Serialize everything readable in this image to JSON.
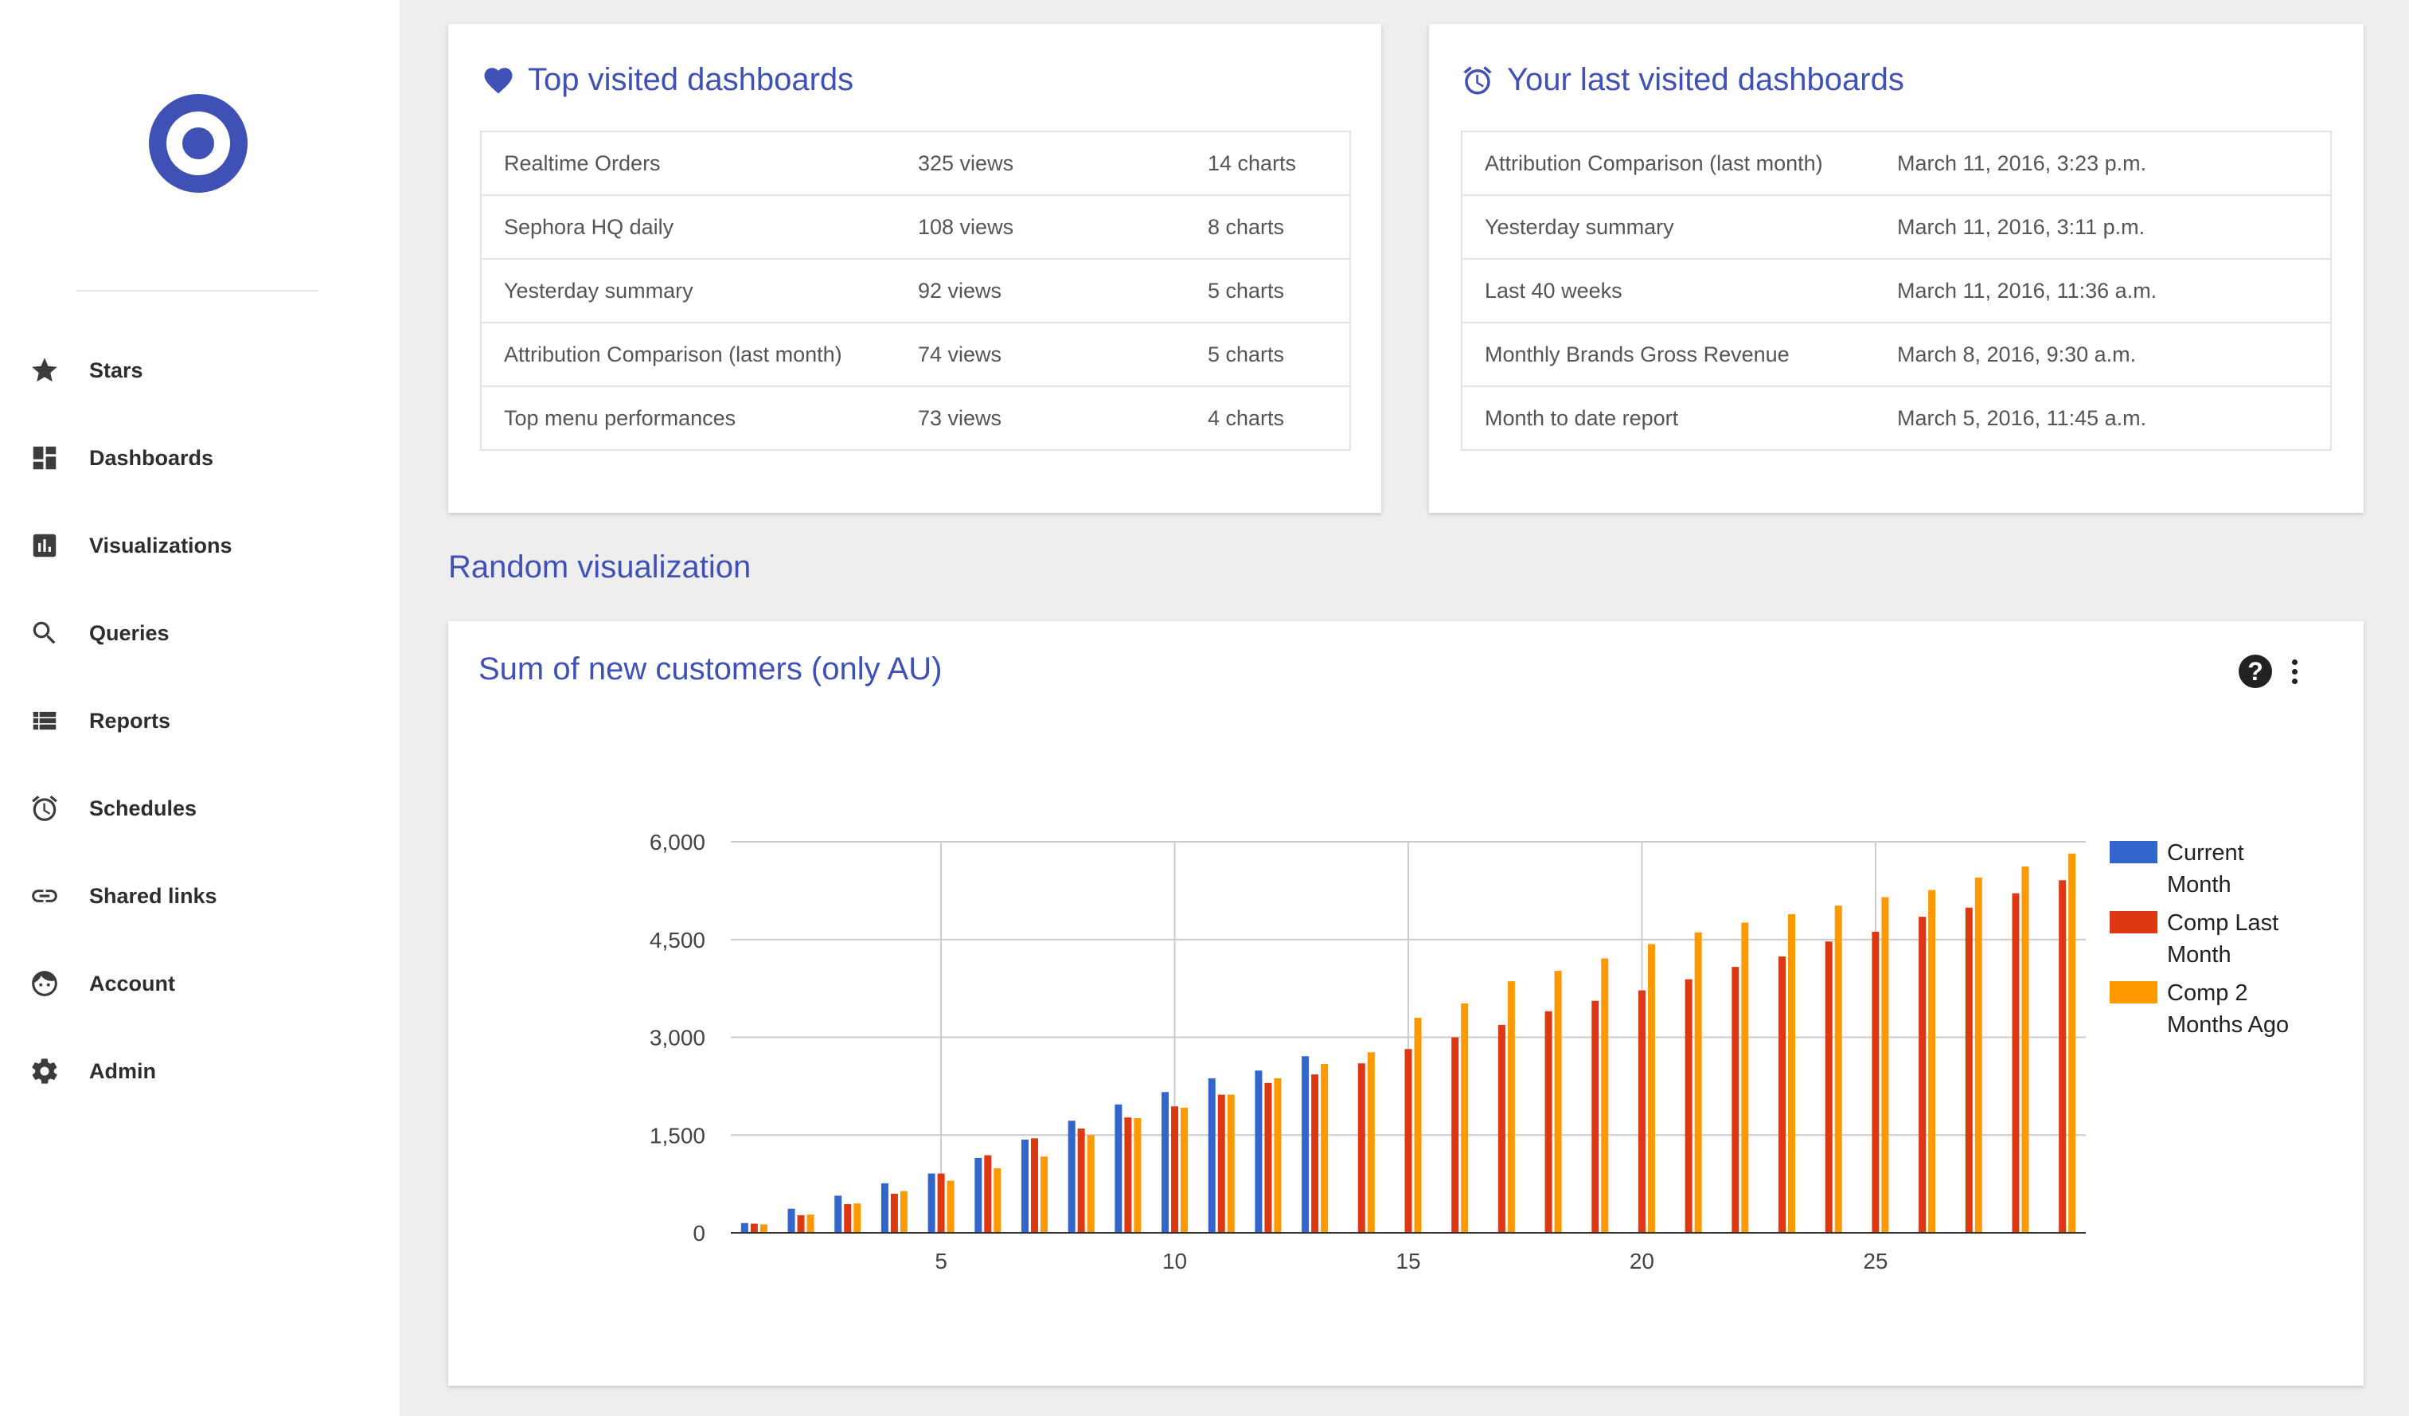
{
  "sidebar": {
    "items": [
      {
        "label": "Stars",
        "icon": "star-icon"
      },
      {
        "label": "Dashboards",
        "icon": "dashboards-icon"
      },
      {
        "label": "Visualizations",
        "icon": "visualizations-icon"
      },
      {
        "label": "Queries",
        "icon": "search-icon"
      },
      {
        "label": "Reports",
        "icon": "reports-icon"
      },
      {
        "label": "Schedules",
        "icon": "alarm-icon"
      },
      {
        "label": "Shared links",
        "icon": "link-icon"
      },
      {
        "label": "Account",
        "icon": "account-icon"
      },
      {
        "label": "Admin",
        "icon": "gear-icon"
      }
    ]
  },
  "top_visited": {
    "title": "Top visited dashboards",
    "rows": [
      {
        "name": "Realtime Orders",
        "views": "325 views",
        "charts": "14 charts"
      },
      {
        "name": "Sephora HQ daily",
        "views": "108 views",
        "charts": "8 charts"
      },
      {
        "name": "Yesterday summary",
        "views": "92 views",
        "charts": "5 charts"
      },
      {
        "name": "Attribution Comparison (last month)",
        "views": "74 views",
        "charts": "5 charts"
      },
      {
        "name": "Top menu performances",
        "views": "73 views",
        "charts": "4 charts"
      }
    ]
  },
  "last_visited": {
    "title": "Your last visited dashboards",
    "rows": [
      {
        "name": "Attribution Comparison (last month)",
        "date": "March 11, 2016, 3:23 p.m."
      },
      {
        "name": "Yesterday summary",
        "date": "March 11, 2016, 3:11 p.m."
      },
      {
        "name": "Last 40 weeks",
        "date": "March 11, 2016, 11:36 a.m."
      },
      {
        "name": "Monthly Brands Gross Revenue",
        "date": "March 8, 2016, 9:30 a.m."
      },
      {
        "name": "Month to date report",
        "date": "March 5, 2016, 11:45 a.m."
      }
    ]
  },
  "section_title": "Random visualization",
  "chart_title": "Sum of new customers (only AU)",
  "help_glyph": "?",
  "chart_data": {
    "type": "bar",
    "title": "Sum of new customers (only AU)",
    "x": [
      1,
      2,
      3,
      4,
      5,
      6,
      7,
      8,
      9,
      10,
      11,
      12,
      13,
      14,
      15,
      16,
      17,
      18,
      19,
      20,
      21,
      22,
      23,
      24,
      25,
      26,
      27,
      28,
      29
    ],
    "x_ticks": [
      5,
      10,
      15,
      20,
      25
    ],
    "x_tick_labels": [
      "5",
      "10",
      "15",
      "20",
      "25"
    ],
    "ylim": [
      0,
      6000
    ],
    "y_ticks": [
      0,
      1500,
      3000,
      4500,
      6000
    ],
    "y_tick_labels": [
      "0",
      "1,500",
      "3,000",
      "4,500",
      "6,000"
    ],
    "grid": true,
    "legend_position": "right",
    "series": [
      {
        "name": "Current Month",
        "color": "#3366cc",
        "values": [
          150,
          370,
          570,
          760,
          910,
          1150,
          1430,
          1720,
          1970,
          2160,
          2370,
          2490,
          2710,
          null,
          null,
          null,
          null,
          null,
          null,
          null,
          null,
          null,
          null,
          null,
          null,
          null,
          null,
          null,
          null
        ]
      },
      {
        "name": "Comp Last Month",
        "color": "#dc3912",
        "values": [
          140,
          270,
          440,
          600,
          910,
          1190,
          1450,
          1600,
          1770,
          1940,
          2120,
          2300,
          2430,
          2600,
          2820,
          3000,
          3190,
          3400,
          3560,
          3720,
          3890,
          4080,
          4240,
          4470,
          4620,
          4850,
          4990,
          5210,
          5410
        ]
      },
      {
        "name": "Comp 2 Months Ago",
        "color": "#ff9900",
        "values": [
          130,
          280,
          450,
          640,
          800,
          990,
          1170,
          1500,
          1760,
          1920,
          2120,
          2370,
          2590,
          2770,
          3300,
          3520,
          3860,
          4020,
          4210,
          4430,
          4610,
          4760,
          4890,
          5020,
          5150,
          5260,
          5450,
          5620,
          5820
        ]
      }
    ]
  }
}
